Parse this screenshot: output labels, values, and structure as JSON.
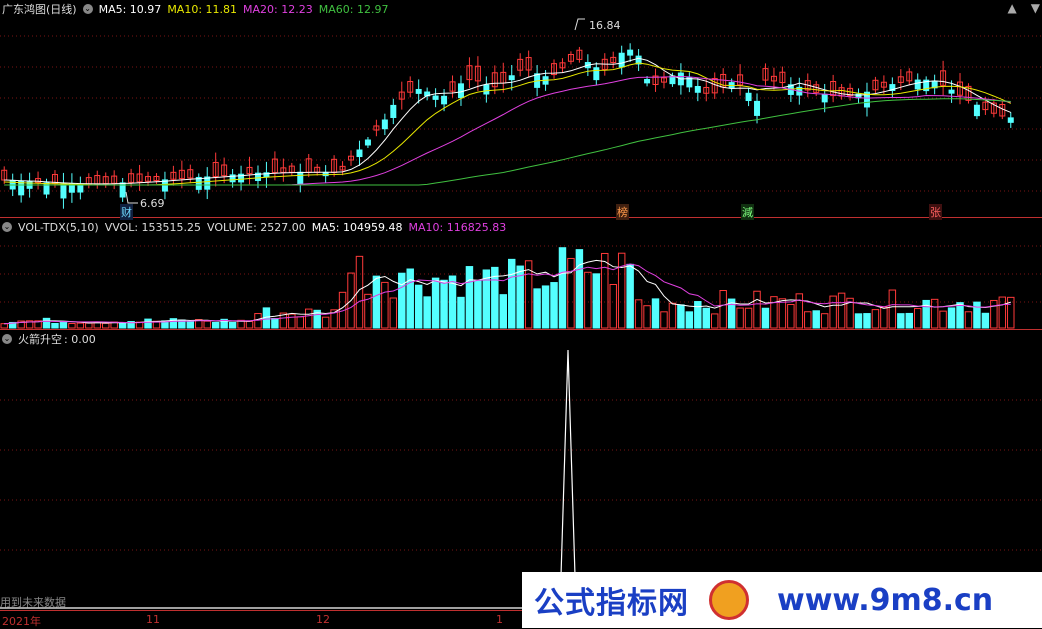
{
  "main_panel": {
    "title": "广东鸿图(日线)",
    "ma5_label": "MA5: 10.97",
    "ma10_label": "MA10: 11.81",
    "ma20_label": "MA20: 12.23",
    "ma60_label": "MA60: 12.97",
    "high_marker": "16.84",
    "low_marker": "6.69",
    "tags": [
      "财",
      "榜",
      "減",
      "张"
    ],
    "colors": {
      "ma5": "#ffffff",
      "ma10": "#e8e800",
      "ma20": "#e040e0",
      "ma60": "#40c040"
    }
  },
  "volume_panel": {
    "title": "VOL-TDX(5,10)",
    "vvol_label": "VVOL: 153515.25",
    "volume_label": "VOLUME: 2527.00",
    "ma5_label": "MA5: 104959.48",
    "ma10_label": "MA10: 116825.83"
  },
  "indicator_panel": {
    "title": "火箭升空",
    "value_label": ": 0.00"
  },
  "bottom": {
    "note": "用到未来数据",
    "axis_labels": [
      "2021年",
      "11",
      "12",
      "1"
    ]
  },
  "watermark": {
    "text": "公式指标网",
    "url": "www.9m8.cn"
  },
  "top_right": {
    "up_icon": "up-arrow-icon",
    "down_icon": "down-arrow-icon"
  }
}
